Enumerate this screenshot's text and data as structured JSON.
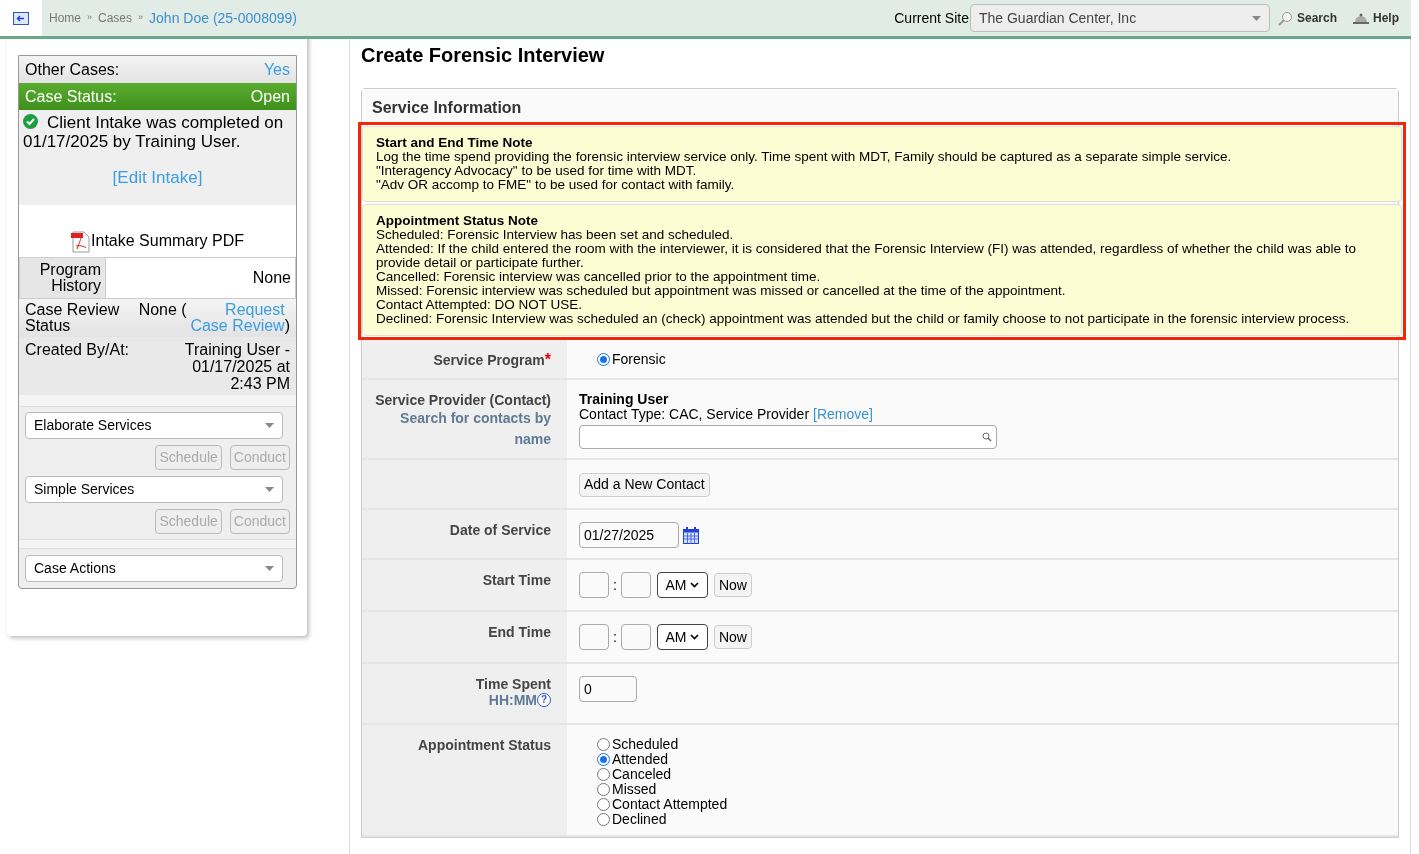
{
  "breadcrumb": [
    {
      "label": "Home",
      "kind": "plain"
    },
    {
      "label": "»",
      "kind": "sep"
    },
    {
      "label": "Cases",
      "kind": "plain"
    },
    {
      "label": "»",
      "kind": "sep"
    },
    {
      "label": "John Doe (25-0008099)",
      "kind": "link"
    }
  ],
  "header": {
    "site_label": "Current Site",
    "site": "The Guardian Center, Inc",
    "search": "Search",
    "help": "Help"
  },
  "sidebar": {
    "rows": [
      {
        "label": "Other Cases:",
        "value": "Yes",
        "kind": "link"
      },
      {
        "label": "Case Status:",
        "value": "Open",
        "kind": "status"
      }
    ],
    "intake_note": "Client Intake was completed on 01/17/2025 by Training User.",
    "edit_intake": "[Edit Intake]",
    "pdf": "Intake Summary PDF",
    "program_history": {
      "label": "Program History",
      "value": "None"
    },
    "review": {
      "label": "Case Review Status",
      "value": "None (",
      "link": "Request Case Review",
      "end": ")"
    },
    "created": {
      "label": "Created By/At:",
      "value": "Training User - 01/17/2025 at 2:43 PM"
    },
    "groups": [
      {
        "select": "Elaborate Services",
        "buttons": [
          {
            "label": "Schedule",
            "disabled": true
          },
          {
            "label": "Conduct",
            "disabled": true
          }
        ]
      },
      {
        "select": "Simple Services",
        "buttons": [
          {
            "label": "Schedule",
            "disabled": true
          },
          {
            "label": "Conduct",
            "disabled": true
          }
        ]
      }
    ],
    "case_actions": "Case Actions"
  },
  "page_title": "Create Forensic Interview",
  "section_title": "Service Information",
  "notes": [
    {
      "title": "Start and End Time Note",
      "lines": [
        "Log the time spend providing the forensic interview service only. Time spent with MDT, Family should be captured as a separate simple service.",
        "\"Interagency Advocacy\" to be used for time with MDT.",
        "\"Adv OR accomp to FME\" to be used for contact with family."
      ]
    },
    {
      "title": "Appointment Status Note",
      "lines": [
        "Scheduled: Forensic Interview has been set and scheduled.",
        "Attended: If the child entered the room with the interviewer, it is considered that the Forensic Interview (FI) was attended, regardless of whether the child was able to provide detail or participate further.",
        "Cancelled: Forensic interview was cancelled prior to the appointment time.",
        "Missed: Forensic interview was scheduled but appointment was missed or cancelled at the time of the appointment.",
        "Contact Attempted: DO NOT USE.",
        "Declined: Forensic Interview was scheduled an (check) appointment was attended but the child or family choose to not participate in the forensic interview process."
      ]
    }
  ],
  "form": [
    {
      "kind": "radio",
      "label": "Service Program",
      "required": "*",
      "options": [
        {
          "label": "Forensic",
          "selected": true
        }
      ]
    },
    {
      "kind": "contact",
      "label": "Service Provider (Contact)",
      "hint": "Search for contacts by name",
      "name": "Training User",
      "type": "Contact Type: CAC, Service Provider",
      "remove": "[Remove]"
    },
    {
      "kind": "button",
      "button": "Add a New Contact"
    },
    {
      "kind": "date",
      "label": "Date of Service",
      "value": "01/27/2025"
    },
    {
      "kind": "time",
      "label": "Start Time",
      "sep": ":",
      "ampm": "AM",
      "now": "Now"
    },
    {
      "kind": "time",
      "label": "End Time",
      "sep": ":",
      "ampm": "AM",
      "now": "Now"
    },
    {
      "kind": "spent",
      "label": "Time Spent",
      "hint": "HH:MM",
      "help": "?",
      "value": "0"
    },
    {
      "kind": "radio",
      "label": "Appointment Status",
      "options": [
        {
          "label": "Scheduled",
          "selected": false
        },
        {
          "label": "Attended",
          "selected": true
        },
        {
          "label": "Canceled",
          "selected": false
        },
        {
          "label": "Missed",
          "selected": false
        },
        {
          "label": "Contact Attempted",
          "selected": false
        },
        {
          "label": "Declined",
          "selected": false
        }
      ]
    }
  ]
}
